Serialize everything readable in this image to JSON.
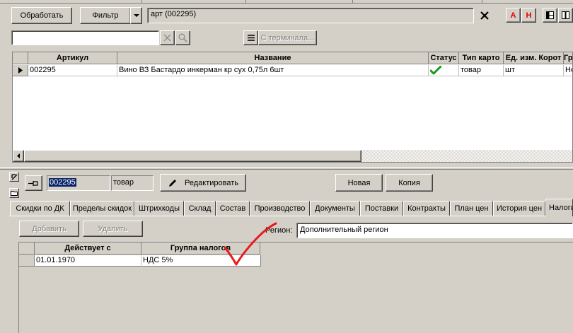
{
  "toolbar": {
    "process_label": "Обработать",
    "filter_label": "Фильтр",
    "filter_text": "арт (002295)",
    "terminal_label": "С терминала...",
    "btn_a": "A",
    "btn_h": "H"
  },
  "search": {
    "value": "",
    "placeholder": ""
  },
  "main_table": {
    "columns": [
      "Артикул",
      "Название",
      "Статус",
      "Тип карто",
      "Ед. изм. Корот",
      "Гр"
    ],
    "rows": [
      {
        "article": "002295",
        "name": "Вино  ВЗ  Бастардо инкерман  кр сух 0,75л 6шт",
        "status": "ok",
        "type": "товар",
        "unit": "шт",
        "group": "Не"
      }
    ]
  },
  "detail": {
    "code": "002295",
    "type": "товар",
    "edit_label": "Редактировать",
    "new_label": "Новая",
    "copy_label": "Копия"
  },
  "tabs": [
    "Скидки по ДК",
    "Пределы скидок",
    "Штрихкоды",
    "Склад",
    "Состав",
    "Производство",
    "Документы",
    "Поставки",
    "Контракты",
    "План цен",
    "История цен",
    "Налоги"
  ],
  "tax_panel": {
    "add_label": "Добавить",
    "delete_label": "Удалить",
    "region_label": "Регион:",
    "region_value": "Дополнительный регион",
    "columns": [
      "Действует с",
      "Группа налогов"
    ],
    "rows": [
      {
        "date": "01.01.1970",
        "group": "НДС 5%"
      }
    ]
  },
  "colors": {
    "face": "#d4d0c8",
    "accent_red": "#e00000",
    "check_green": "#1a9a1a",
    "annotation_red": "#e8191b"
  }
}
